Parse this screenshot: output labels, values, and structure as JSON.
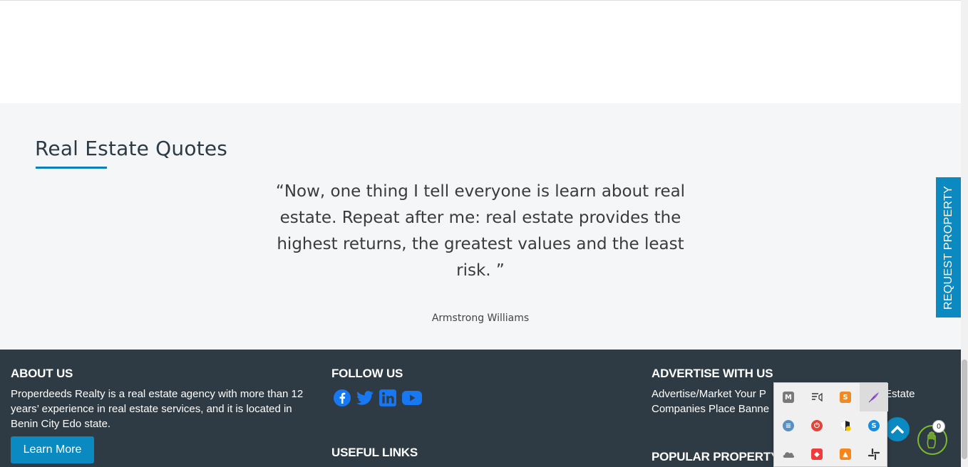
{
  "quotes": {
    "title": "Real Estate Quotes",
    "text": "“Now, one thing I tell everyone is learn about real estate. Repeat after me: real estate provides the highest returns, the greatest values and the least risk. ”",
    "author": "Armstrong Williams"
  },
  "footer": {
    "about": {
      "heading": "ABOUT US",
      "text": "Properdeeds Realty is a real estate agency with more than 12 years’ experience in real estate services, and it is located in Benin City Edo state.",
      "button": "Learn More"
    },
    "follow": {
      "heading": "FOLLOW US",
      "icons": [
        "facebook-icon",
        "twitter-icon",
        "linkedin-icon",
        "youtube-icon"
      ],
      "useful_links_heading": "USEFUL LINKS"
    },
    "advertise": {
      "heading": "ADVERTISE WITH US",
      "text_line1_start": "Advertise/Market Your P",
      "text_line1_end": "Estate",
      "text_line2": "Companies Place Banne",
      "popular_heading": "POPULAR PROPERTY"
    }
  },
  "request_tab": {
    "label": "REQUEST PROPERTY"
  },
  "hand_badge": {
    "count": "0"
  },
  "colors": {
    "accent": "#0b8ac2",
    "footer_bg": "#2f3b44",
    "section_bg": "#f5f6f8"
  },
  "tray": {
    "icons": [
      "mcafee-icon",
      "notification-icon",
      "sublime-icon",
      "feather-icon",
      "storage-icon",
      "power-icon",
      "shield-warning-icon",
      "skype-icon",
      "onedrive-icon",
      "anydesk-icon",
      "metamask-icon",
      "slack-icon"
    ]
  }
}
